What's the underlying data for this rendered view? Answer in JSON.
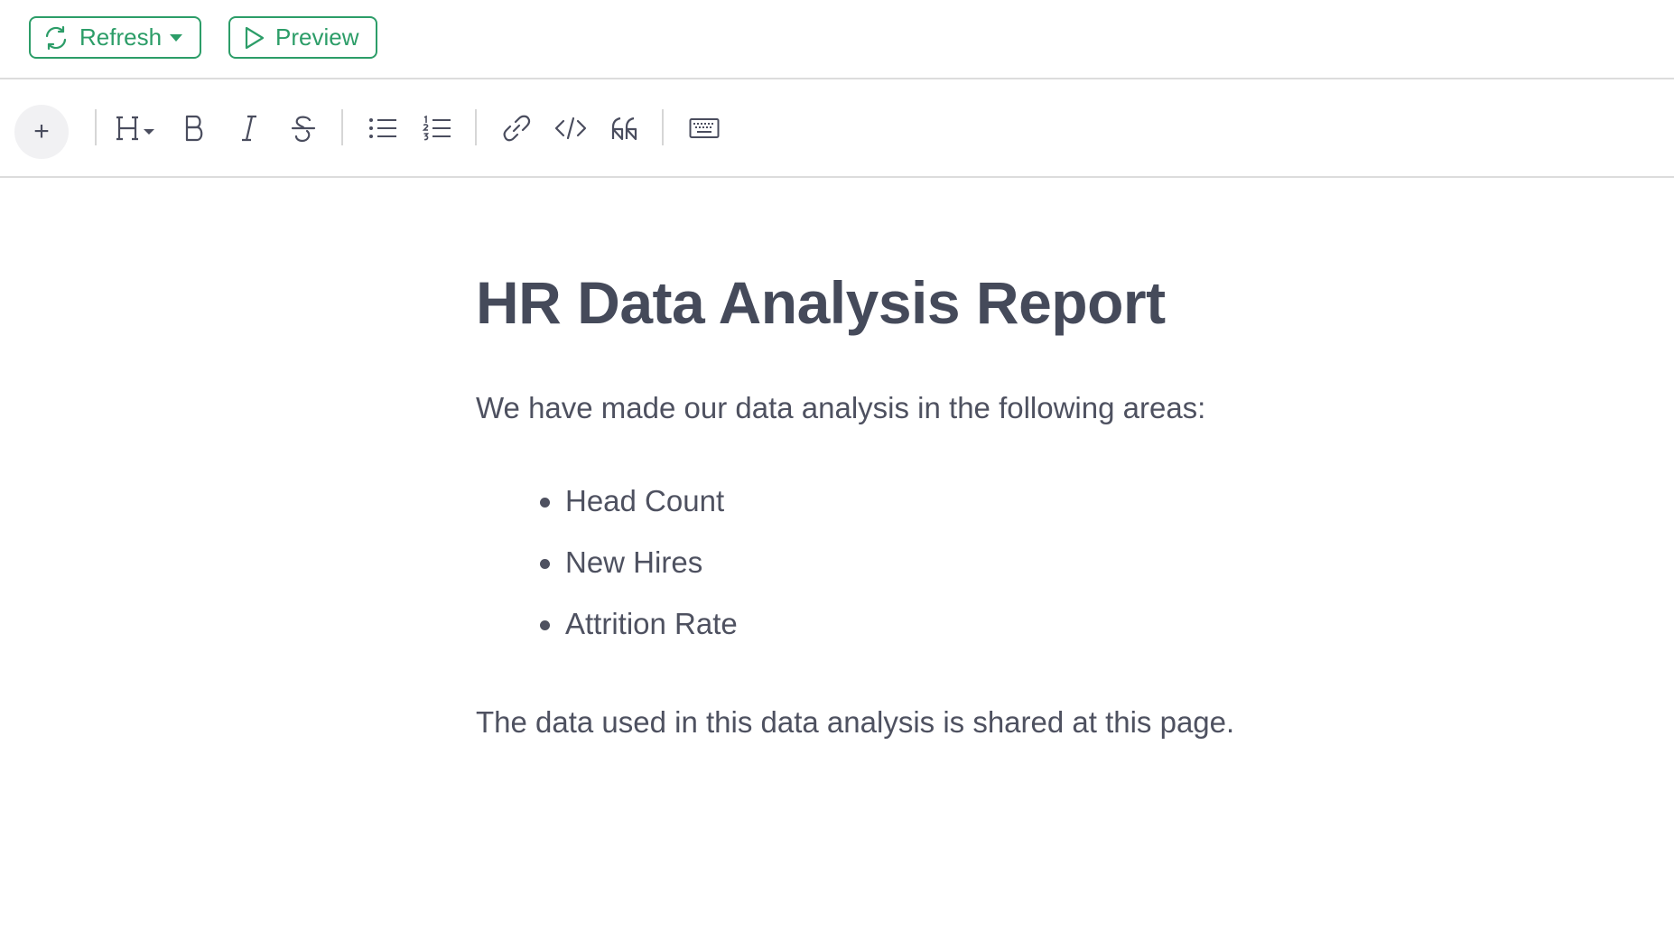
{
  "header": {
    "refresh_label": "Refresh",
    "preview_label": "Preview",
    "accent_color": "#2c9d68"
  },
  "toolbar": {
    "add_symbol": "+",
    "tools": [
      "heading-icon",
      "bold-icon",
      "italic-icon",
      "strikethrough-icon",
      "bulleted-list-icon",
      "numbered-list-icon",
      "link-icon",
      "code-icon",
      "quote-icon",
      "keyboard-icon"
    ]
  },
  "document": {
    "title": "HR Data Analysis Report",
    "intro": "We have made our data analysis in the following areas:",
    "bullets": [
      "Head Count",
      "New Hires",
      "Attrition Rate"
    ],
    "closing": "The data used in this data analysis is shared at this page."
  }
}
